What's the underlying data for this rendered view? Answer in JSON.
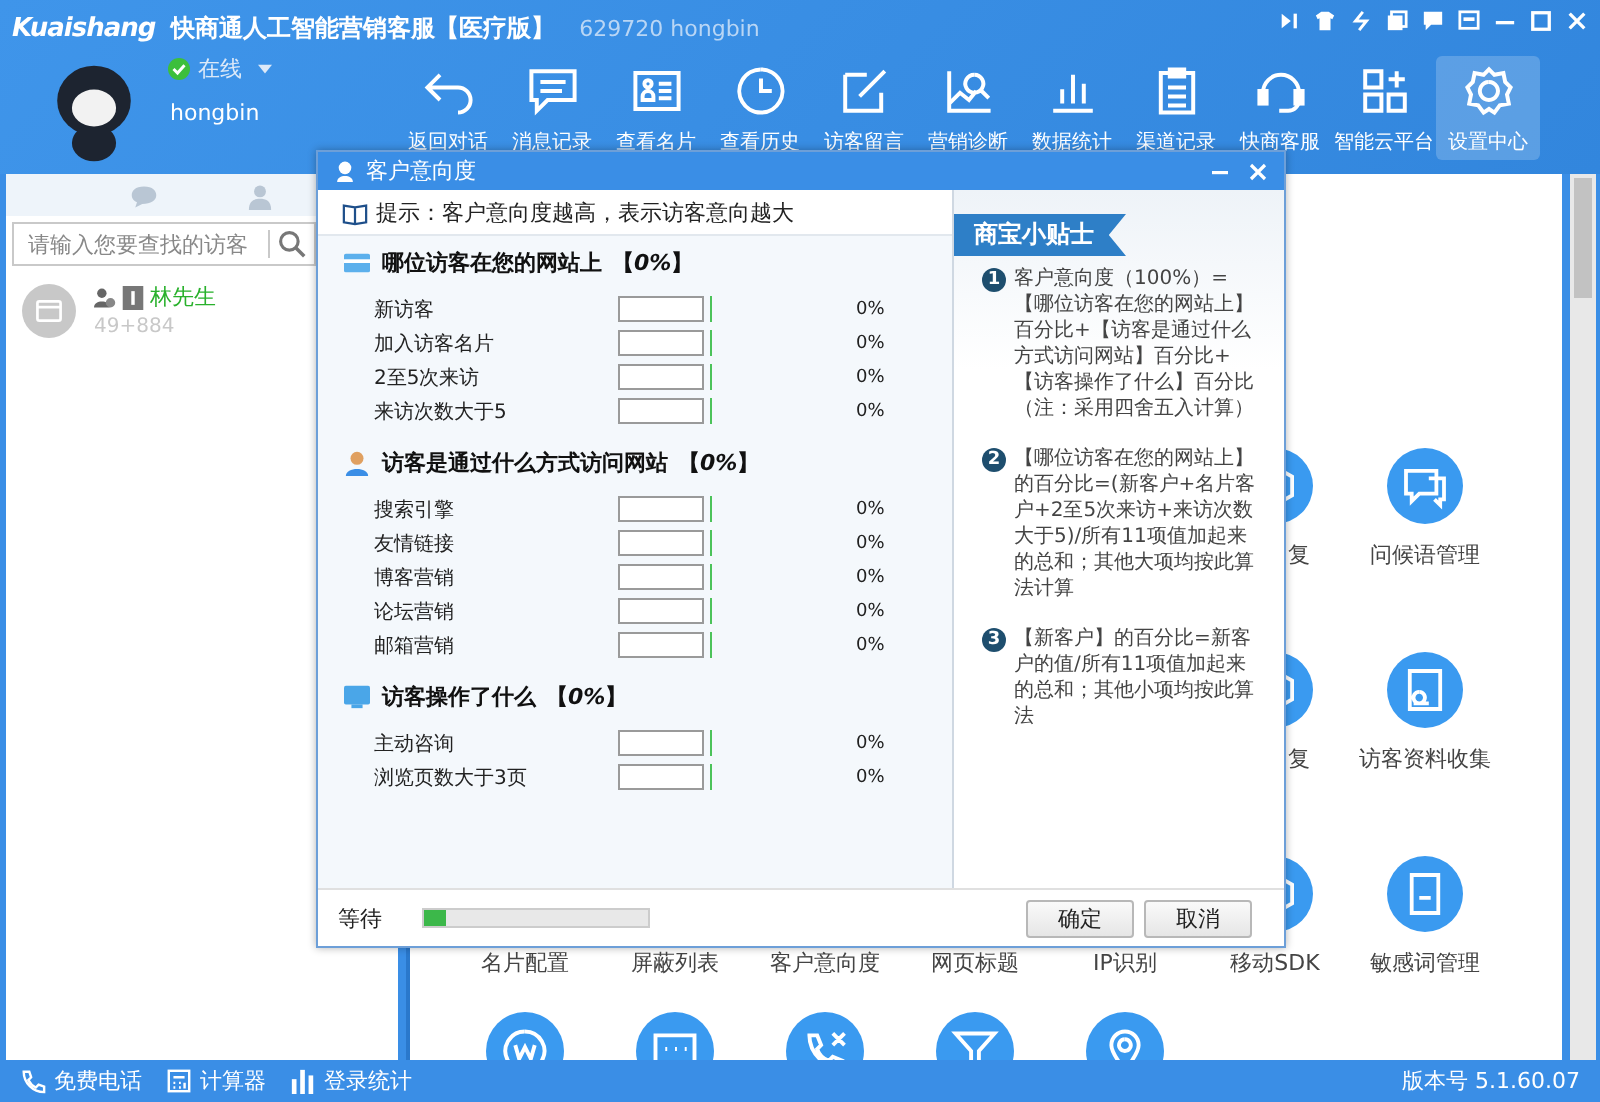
{
  "window": {
    "logo": "Kuaishang",
    "title": "快商通人工智能营销客服【医疗版】",
    "account": "629720 hongbin"
  },
  "user": {
    "status": "在线",
    "name": "hongbin"
  },
  "toolbar": [
    {
      "label": "返回对话",
      "selected": false
    },
    {
      "label": "消息记录",
      "selected": false
    },
    {
      "label": "查看名片",
      "selected": false
    },
    {
      "label": "查看历史",
      "selected": false
    },
    {
      "label": "访客留言",
      "selected": false
    },
    {
      "label": "营销诊断",
      "selected": false
    },
    {
      "label": "数据统计",
      "selected": false
    },
    {
      "label": "渠道记录",
      "selected": false
    },
    {
      "label": "快商客服",
      "selected": false
    },
    {
      "label": "智能云平台",
      "selected": false
    },
    {
      "label": "设置中心",
      "selected": true
    }
  ],
  "search": {
    "placeholder": "请输入您要查找的访客"
  },
  "visitors": [
    {
      "name": "林先生",
      "detail": "49+884"
    }
  ],
  "settings_grid": {
    "rows": [
      {
        "items": [
          {
            "label": "复",
            "kind": "partial"
          },
          {
            "label": "问候语管理",
            "kind": "full"
          }
        ]
      },
      {
        "items": [
          {
            "label": "复",
            "kind": "partial"
          },
          {
            "label": "访客资料收集",
            "kind": "full"
          }
        ]
      },
      {
        "items": [
          {
            "label": "名片配置",
            "kind": "label"
          },
          {
            "label": "屏蔽列表",
            "kind": "label"
          },
          {
            "label": "客户意向度",
            "kind": "label"
          },
          {
            "label": "网页标题",
            "kind": "label"
          },
          {
            "label": "IP识别",
            "kind": "label"
          },
          {
            "label": "移动SDK",
            "kind": "full"
          },
          {
            "label": "敏感词管理",
            "kind": "full"
          }
        ]
      },
      {
        "items": [
          {
            "kind": "icon"
          },
          {
            "kind": "icon"
          },
          {
            "kind": "icon"
          },
          {
            "kind": "icon"
          },
          {
            "kind": "icon"
          }
        ]
      }
    ]
  },
  "dialog": {
    "title": "客户意向度",
    "hint": "提示：客户意向度越高，表示访客意向越大",
    "sections": [
      {
        "title": "哪位访客在您的网站上",
        "percent": "【*0%*】",
        "items": [
          {
            "label": "新访客",
            "level": 0,
            "value": "0%"
          },
          {
            "label": "加入访客名片",
            "level": 0,
            "value": "0%"
          },
          {
            "label": "2至5次来访",
            "level": 0,
            "value": "0%"
          },
          {
            "label": "来访次数大于5",
            "level": 0,
            "value": "0%"
          }
        ]
      },
      {
        "title": "访客是通过什么方式访问网站",
        "percent": "【*0%*】",
        "items": [
          {
            "label": "搜索引擎",
            "level": 0,
            "value": "0%"
          },
          {
            "label": "友情链接",
            "level": 0,
            "value": "0%"
          },
          {
            "label": "博客营销",
            "level": 0,
            "value": "0%"
          },
          {
            "label": "论坛营销",
            "level": 0,
            "value": "0%"
          },
          {
            "label": "邮箱营销",
            "level": 0,
            "value": "0%"
          }
        ]
      },
      {
        "title": "访客操作了什么",
        "percent": "【*0%*】",
        "items": [
          {
            "label": "主动咨询",
            "level": 0,
            "value": "0%"
          },
          {
            "label": "浏览页数大于3页",
            "level": 0,
            "value": "0%"
          }
        ]
      }
    ],
    "tips": {
      "title": "商宝小贴士",
      "items": [
        {
          "number": "1",
          "text": "客户意向度（100%）=【哪位访客在您的网站上】百分比+【访客是通过什么方式访问网站】百分比+【访客操作了什么】百分比（注：采用四舍五入计算）"
        },
        {
          "number": "2",
          "text": "【哪位访客在您的网站上】的百分比=(新客户+名片客户+2至5次来访+来访次数大于5)/所有11项值加起来的总和；其他大项均按此算法计算"
        },
        {
          "number": "3",
          "text": "【新客户】的百分比=新客户的值/所有11项值加起来的总和；其他小项均按此算法"
        }
      ]
    },
    "footer": {
      "status": "等待",
      "level": 0.1
    },
    "buttons": [
      "确定",
      "取消"
    ]
  },
  "status_bar": {
    "items": [
      "免费电话",
      "计算器",
      "登录统计"
    ],
    "version": "版本号 5.1.60.07"
  }
}
